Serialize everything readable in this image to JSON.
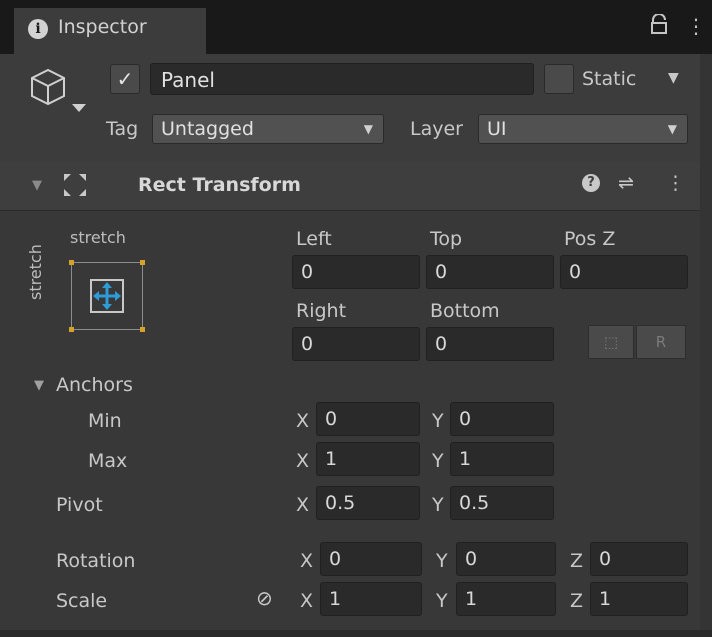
{
  "tab": {
    "title": "Inspector",
    "info_icon": "info-icon",
    "lock_icon": "ა",
    "menu_icon": "⋮"
  },
  "gameobject": {
    "active": true,
    "active_glyph": "✓",
    "name": "Panel",
    "static_label": "Static",
    "static_arrow": "▼",
    "tag_label": "Tag",
    "tag_value": "Untagged",
    "layer_label": "Layer",
    "layer_value": "UI",
    "dropdown_arrow": "▼"
  },
  "component": {
    "fold_glyph": "▼",
    "title": "Rect Transform",
    "help_glyph": "?",
    "preset_glyph": "⇌",
    "menu_glyph": "⋮"
  },
  "anchor_preset": {
    "horizontal": "stretch",
    "vertical": "stretch"
  },
  "rect": {
    "left_label": "Left",
    "left": "0",
    "top_label": "Top",
    "top": "0",
    "posz_label": "Pos Z",
    "posz": "0",
    "right_label": "Right",
    "right": "0",
    "bottom_label": "Bottom",
    "bottom": "0",
    "blueprint_glyph": "⬚",
    "raw_label": "R"
  },
  "anchors": {
    "fold_glyph": "▼",
    "label": "Anchors",
    "min_label": "Min",
    "min_x": "0",
    "min_y": "0",
    "max_label": "Max",
    "max_x": "1",
    "max_y": "1"
  },
  "pivot": {
    "label": "Pivot",
    "x": "0.5",
    "y": "0.5"
  },
  "rotation": {
    "label": "Rotation",
    "x": "0",
    "y": "0",
    "z": "0"
  },
  "scale": {
    "label": "Scale",
    "link_glyph": "⊘",
    "x": "1",
    "y": "1",
    "z": "1"
  },
  "axis": {
    "x": "X",
    "y": "Y",
    "z": "Z"
  },
  "colors": {
    "background": "#383838",
    "field": "#2a2a2a",
    "accent_blue": "#2e9ad6",
    "anchor_handle": "#d4a12b"
  }
}
